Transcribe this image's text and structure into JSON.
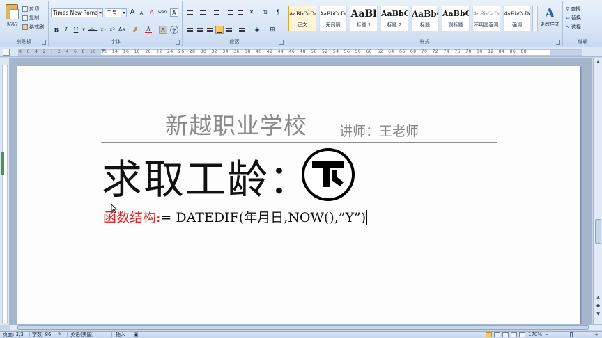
{
  "ribbon": {
    "clipboard": {
      "group_label": "剪贴板",
      "paste": "粘贴",
      "cut": "剪切",
      "copy": "复制",
      "format_painter": "格式刷"
    },
    "font": {
      "group_label": "字体",
      "font_name": "Times New Roman",
      "font_size": "三号",
      "bold": "B",
      "italic": "I",
      "underline": "U",
      "strikethrough": "abc",
      "subscript": "x₂",
      "superscript": "x²",
      "change_case": "Aa",
      "grow": "A",
      "shrink": "A",
      "char_border": "A",
      "phonetic": "wén",
      "clear": "A"
    },
    "paragraph": {
      "group_label": "段落"
    },
    "styles": {
      "group_label": "样式",
      "tiles": [
        {
          "sample": "AaBbCcDd",
          "name": "正文"
        },
        {
          "sample": "AaBbCcDd",
          "name": "无间隔"
        },
        {
          "sample": "AaBl",
          "name": "标题 1"
        },
        {
          "sample": "AaBbC",
          "name": "标题 2"
        },
        {
          "sample": "AaBbC",
          "name": "标题"
        },
        {
          "sample": "AaBbC",
          "name": "副标题"
        },
        {
          "sample": "AaBbCcDd",
          "name": "不明显强调"
        },
        {
          "sample": "AaBbCcDd",
          "name": "强调"
        }
      ],
      "change_styles": "更改样式"
    },
    "editing": {
      "group_label": "编辑",
      "find": "查找",
      "replace": "替换",
      "select": "选择"
    }
  },
  "ruler": {
    "numbers": "8 · 6 · 4 · 2 · | · 2 · 4 · 6 · 8 · 10 · 12 · 14 · 16 · 18 · 20 · 22 · 24 · 26 · 28 · 30 · 32 · 34 · 36 · 38 · 40 · 42 · 44 · 46 · 48 · 50 · 52 · 54 · 56 · 58 · 60 · 62 · 64 · 66 · 68 · 70 · 72 · 74 · 76 · 78 · 80 · 82 · 84 · 86 · 88"
  },
  "document": {
    "school_name": "新越职业学校",
    "teacher": "讲师：王老师",
    "title": "求取工龄：",
    "formula_label": "函数结构:",
    "formula_body": "= DATEDIF(年月日,NOW(),”Y”)"
  },
  "statusbar": {
    "page": "页面: 3/3",
    "word_count": "字数: 86",
    "language": "英语(美国)",
    "mode": "插入",
    "zoom": "170%"
  },
  "colors": {
    "accent_red": "#e02020",
    "ribbon_bg": "#d5e3f4",
    "header_gray": "#8a8a8a"
  }
}
